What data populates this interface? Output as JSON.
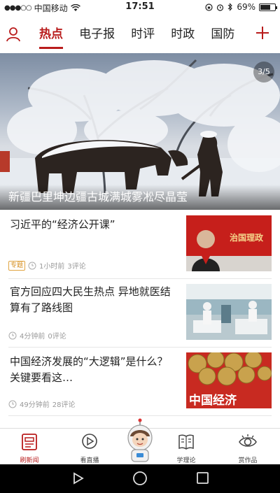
{
  "status_bar": {
    "carrier": "中国移动",
    "time": "17:51",
    "battery": "69%",
    "battery_level": 0.69
  },
  "nav": {
    "tabs": [
      "热点",
      "电子报",
      "时评",
      "时政",
      "国防"
    ],
    "active_tab": "热点"
  },
  "hero": {
    "caption": "新疆巴里坤边疆古城满城雾凇尽晶莹",
    "pager": "3/5"
  },
  "news": [
    {
      "title": "习近平的“经济公开课”",
      "badge": "专题",
      "time": "1小时前",
      "comments": "3评论",
      "thumb_text": "治国理政"
    },
    {
      "title": "官方回应四大民生热点 异地就医结算有了路线图",
      "badge": "",
      "time": "4分钟前",
      "comments": "0评论",
      "thumb_text": ""
    },
    {
      "title": "中国经济发展的“大逻辑”是什么？关键要看这…",
      "badge": "",
      "time": "49分钟前",
      "comments": "28评论",
      "thumb_text": "中国经济"
    }
  ],
  "bottom_tabs": [
    {
      "label": "刷新闻",
      "active": true
    },
    {
      "label": "看直播",
      "active": false
    },
    {
      "label": "学理论",
      "active": false
    },
    {
      "label": "赏作品",
      "active": false
    }
  ],
  "colors": {
    "accent": "#b91c1c"
  }
}
